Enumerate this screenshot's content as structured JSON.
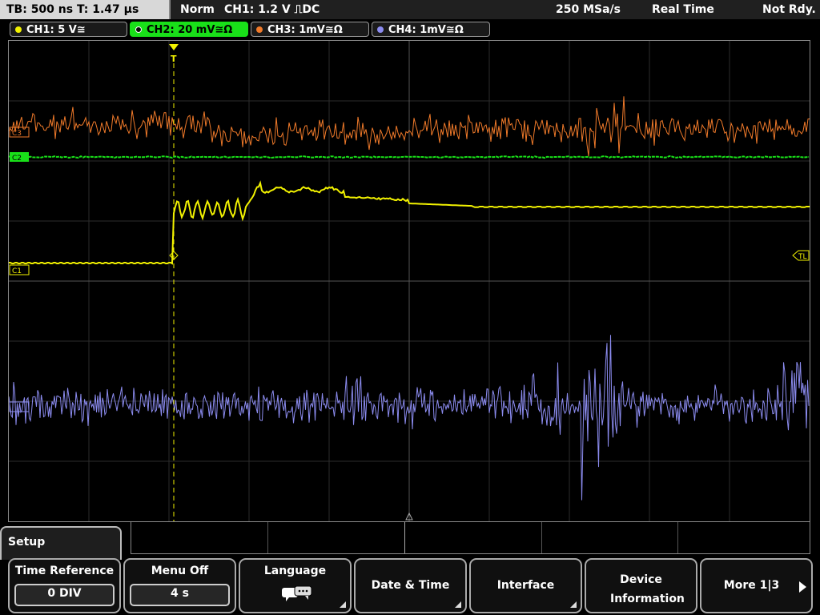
{
  "status_bar": {
    "timebase": "TB: 500 ns   T: 1.47 µs",
    "trigger_mode": "Norm",
    "trigger_info": "CH1: 1.2 V ⎍DC",
    "sample_rate": "250 MSa/s",
    "acq_mode": "Real Time",
    "state": "Not Rdy."
  },
  "channels": [
    {
      "label": "CH1: 5 V≅",
      "color": "#f2f200",
      "active": false
    },
    {
      "label": "CH2: 20 mV≅Ω",
      "color": "#19e019",
      "active": true
    },
    {
      "label": "CH3: 1mV≅Ω",
      "color": "#f07a2a",
      "active": false
    },
    {
      "label": "CH4: 1mV≅Ω",
      "color": "#8c8cf0",
      "active": false
    }
  ],
  "markers": {
    "ch3": "C3",
    "ch2": "C2",
    "ch1": "C1",
    "trigger_level": "TL",
    "trigger_pos": "T"
  },
  "menu": {
    "title": "Setup",
    "softkeys": [
      {
        "label": "Time Reference",
        "value": "0 DIV"
      },
      {
        "label": "Menu Off",
        "value": "4 s"
      },
      {
        "label": "Language",
        "icon": "speech-bubbles-icon"
      },
      {
        "label": "Date & Time"
      },
      {
        "label": "Interface"
      },
      {
        "label": "Device Information"
      },
      {
        "label": "More 1|3"
      }
    ]
  }
}
